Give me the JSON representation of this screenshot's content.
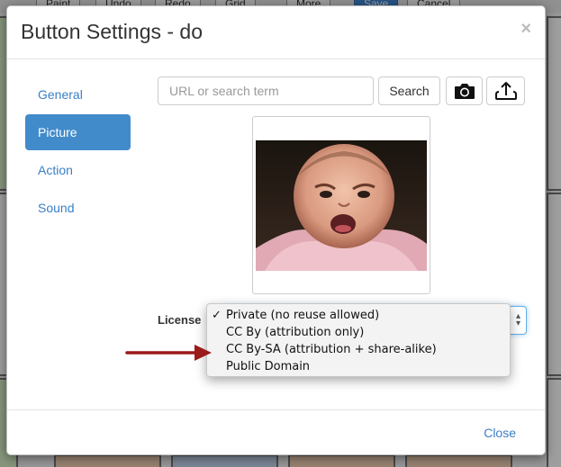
{
  "background_app": {
    "toolbar_buttons": [
      "Paint",
      "Undo",
      "Redo",
      "Grid",
      "More",
      "Save",
      "Cancel"
    ],
    "accent_color": "#428bca"
  },
  "modal": {
    "title": "Button Settings - do",
    "close_glyph": "×",
    "nav": [
      "General",
      "Picture",
      "Action",
      "Sound"
    ],
    "active_nav": "Picture",
    "search": {
      "placeholder": "URL or search term",
      "value": "",
      "button_label": "Search"
    },
    "icons": [
      "camera-icon",
      "upload-icon"
    ],
    "license": {
      "label": "License",
      "options": [
        "Private (no reuse allowed)",
        "CC By (attribution only)",
        "CC By-SA (attribution + share-alike)",
        "Public Domain"
      ],
      "selected": "Private (no reuse allowed)",
      "check_glyph": "✓"
    },
    "footer": {
      "close_label": "Close"
    }
  },
  "annotation": {
    "arrow_color": "#9b1b1b"
  }
}
